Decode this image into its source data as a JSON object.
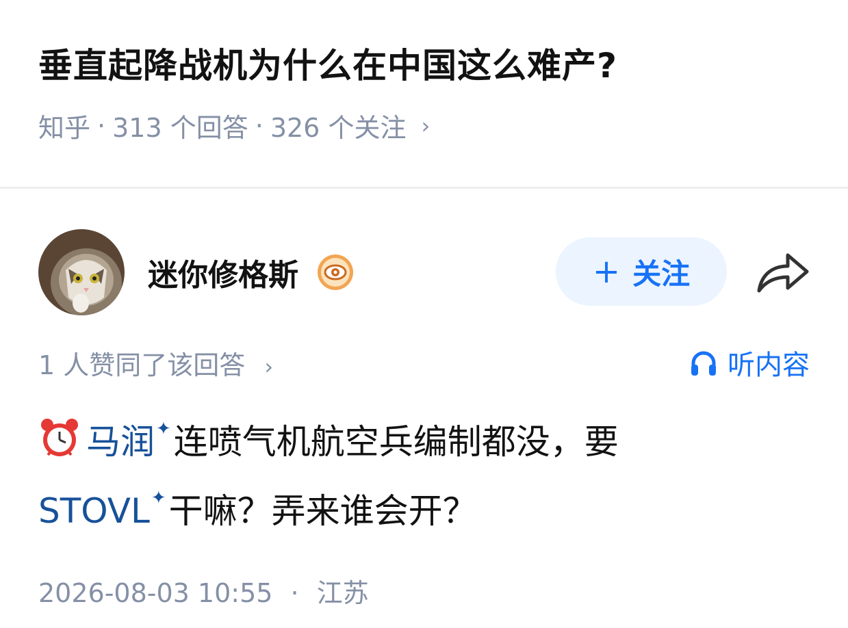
{
  "question": {
    "title": "垂直起降战机为什么在中国这么难产?",
    "source": "知乎",
    "answers": "313 个回答",
    "followers": "326 个关注",
    "separator": "·",
    "chevron": "›"
  },
  "author": {
    "name": "迷你修格斯",
    "badge_icon": "eye-badge-icon",
    "follow_plus": "+",
    "follow_label": "关注",
    "share_icon": "share-arrow-icon"
  },
  "answer": {
    "vote_text": "1 人赞同了该回答",
    "chevron": "›",
    "listen_label": "听内容",
    "emoji": "alarm-clock-icon",
    "link1": "马润",
    "text1": "连喷气机航空兵编制都没，要",
    "link2": "STOVL",
    "text2": "干嘛？弄来谁会开？",
    "spark": "✦",
    "timestamp": "2026-08-03 10:55",
    "dot": "·",
    "location": "江苏"
  },
  "colors": {
    "accent": "#1772f6",
    "meta": "#8590a6",
    "link": "#175199",
    "follow_bg": "#ebf4ff"
  }
}
